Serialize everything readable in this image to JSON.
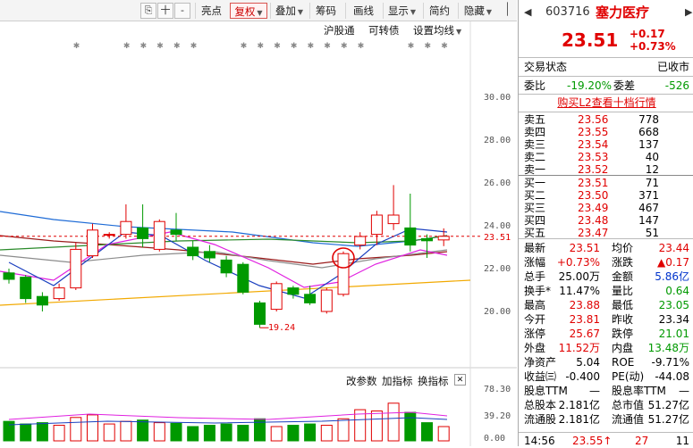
{
  "toolbar": {
    "buttons": [
      "亮点",
      "复权",
      "叠加",
      "筹码",
      "画线",
      "显示",
      "简约",
      "隐藏"
    ],
    "icon_labels": [
      "十",
      "-"
    ]
  },
  "chart_overlay": {
    "links": [
      "沪股通",
      "可转债",
      "设置均线"
    ],
    "indicator_links": [
      "改参数",
      "加指标",
      "换指标"
    ],
    "close_x": "✕",
    "price_ticks": [
      "30.00",
      "28.00",
      "26.00",
      "24.00",
      "22.00",
      "20.00"
    ],
    "current_price_tag": "23.51",
    "low_marker_label": "19.24",
    "volume_ticks": [
      "78.30",
      "39.20",
      "0.00"
    ]
  },
  "colors": {
    "up": "#e00000",
    "down": "#009900",
    "ma_blue": "#1e6bd6",
    "ma_magenta": "#e020e0",
    "ma_orange": "#f2a900",
    "ma_darkred": "#9b1b1b",
    "ma_green": "#2a8a2a"
  },
  "header": {
    "code": "603716",
    "name": "塞力医疗",
    "price": "23.51",
    "change": "+0.17",
    "change_pct": "+0.73%"
  },
  "status": {
    "label": "交易状态",
    "value": "已收市"
  },
  "wei": {
    "wb_label": "委比",
    "wb_value": "-19.20%",
    "wc_label": "委差",
    "wc_value": "-526"
  },
  "l2_link": "购买L2查看十档行情",
  "asks": [
    {
      "label": "卖五",
      "price": "23.56",
      "vol": "778"
    },
    {
      "label": "卖四",
      "price": "23.55",
      "vol": "668"
    },
    {
      "label": "卖三",
      "price": "23.54",
      "vol": "137"
    },
    {
      "label": "卖二",
      "price": "23.53",
      "vol": "40"
    },
    {
      "label": "卖一",
      "price": "23.52",
      "vol": "12"
    }
  ],
  "bids": [
    {
      "label": "买一",
      "price": "23.51",
      "vol": "71"
    },
    {
      "label": "买二",
      "price": "23.50",
      "vol": "371"
    },
    {
      "label": "买三",
      "price": "23.49",
      "vol": "467"
    },
    {
      "label": "买四",
      "price": "23.48",
      "vol": "147"
    },
    {
      "label": "买五",
      "price": "23.47",
      "vol": "51"
    }
  ],
  "stats": [
    {
      "l1": "最新",
      "v1": "23.51",
      "c1": "red",
      "l2": "均价",
      "v2": "23.44",
      "c2": "red"
    },
    {
      "l1": "涨幅",
      "v1": "+0.73%",
      "c1": "red",
      "l2": "涨跌",
      "v2": "▲0.17",
      "c2": "red"
    },
    {
      "l1": "总手",
      "v1": "25.00万",
      "c1": "",
      "l2": "金额",
      "v2": "5.86亿",
      "c2": "blue"
    },
    {
      "l1": "换手*",
      "v1": "11.47%",
      "c1": "",
      "l2": "量比",
      "v2": "0.64",
      "c2": "green"
    },
    {
      "l1": "最高",
      "v1": "23.88",
      "c1": "red",
      "l2": "最低",
      "v2": "23.05",
      "c2": "green"
    },
    {
      "l1": "今开",
      "v1": "23.81",
      "c1": "red",
      "l2": "昨收",
      "v2": "23.34",
      "c2": ""
    },
    {
      "l1": "涨停",
      "v1": "25.67",
      "c1": "red",
      "l2": "跌停",
      "v2": "21.01",
      "c2": "green"
    },
    {
      "l1": "外盘",
      "v1": "11.52万",
      "c1": "red",
      "l2": "内盘",
      "v2": "13.48万",
      "c2": "green"
    },
    {
      "l1": "净资产",
      "v1": "5.04",
      "c1": "",
      "l2": "ROE",
      "v2": "-9.71%",
      "c2": ""
    },
    {
      "l1": "收益㈢",
      "v1": "-0.400",
      "c1": "",
      "l2": "PE(动)",
      "v2": "-44.08",
      "c2": ""
    },
    {
      "l1": "股息TTM",
      "v1": "—",
      "c1": "",
      "l2": "股息率TTM",
      "v2": "—",
      "c2": ""
    },
    {
      "l1": "总股本",
      "v1": "2.181亿",
      "c1": "",
      "l2": "总市值",
      "v2": "51.27亿",
      "c2": ""
    },
    {
      "l1": "流通股",
      "v1": "2.181亿",
      "c1": "",
      "l2": "流通值",
      "v2": "51.27亿",
      "c2": ""
    }
  ],
  "tick_row": {
    "time": "14:56",
    "price": "23.55↑",
    "vol": "27",
    "num": "11"
  },
  "chart_data": {
    "type": "candlestick",
    "ylim": [
      19.0,
      31.0
    ],
    "ticks": [
      30,
      28,
      26,
      24,
      22,
      20
    ],
    "last_price": 23.51,
    "candles": [
      {
        "o": 21.8,
        "c": 21.5,
        "h": 22.0,
        "l": 21.3
      },
      {
        "o": 21.6,
        "c": 20.6,
        "h": 21.7,
        "l": 20.4
      },
      {
        "o": 20.7,
        "c": 20.3,
        "h": 20.9,
        "l": 20.0
      },
      {
        "o": 20.6,
        "c": 21.1,
        "h": 21.3,
        "l": 20.5
      },
      {
        "o": 21.1,
        "c": 22.9,
        "h": 23.2,
        "l": 21.0
      },
      {
        "o": 22.6,
        "c": 23.8,
        "h": 24.1,
        "l": 22.5
      },
      {
        "o": 23.6,
        "c": 23.6,
        "h": 23.7,
        "l": 23.4
      },
      {
        "o": 23.6,
        "c": 24.2,
        "h": 25.0,
        "l": 23.4
      },
      {
        "o": 23.9,
        "c": 23.4,
        "h": 25.0,
        "l": 23.0
      },
      {
        "o": 22.9,
        "c": 24.2,
        "h": 24.3,
        "l": 22.8
      },
      {
        "o": 23.8,
        "c": 23.6,
        "h": 24.6,
        "l": 23.3
      },
      {
        "o": 23.0,
        "c": 22.6,
        "h": 23.3,
        "l": 22.4
      },
      {
        "o": 22.8,
        "c": 22.5,
        "h": 23.1,
        "l": 22.3
      },
      {
        "o": 22.4,
        "c": 21.8,
        "h": 22.6,
        "l": 21.6
      },
      {
        "o": 22.2,
        "c": 20.9,
        "h": 22.3,
        "l": 20.8
      },
      {
        "o": 20.4,
        "c": 19.4,
        "h": 20.5,
        "l": 19.24
      },
      {
        "o": 20.1,
        "c": 21.3,
        "h": 21.4,
        "l": 20.0
      },
      {
        "o": 21.1,
        "c": 20.8,
        "h": 21.2,
        "l": 20.6
      },
      {
        "o": 20.8,
        "c": 20.4,
        "h": 21.2,
        "l": 20.3
      },
      {
        "o": 20.0,
        "c": 21.0,
        "h": 21.1,
        "l": 19.9
      },
      {
        "o": 20.8,
        "c": 22.7,
        "h": 22.8,
        "l": 20.7
      },
      {
        "o": 23.1,
        "c": 23.5,
        "h": 23.7,
        "l": 22.9
      },
      {
        "o": 23.6,
        "c": 24.5,
        "h": 24.7,
        "l": 23.1
      },
      {
        "o": 24.1,
        "c": 24.5,
        "h": 25.9,
        "l": 23.8
      },
      {
        "o": 23.9,
        "c": 23.1,
        "h": 25.5,
        "l": 22.8
      },
      {
        "o": 23.4,
        "c": 23.3,
        "h": 23.6,
        "l": 22.5
      },
      {
        "o": 23.34,
        "c": 23.51,
        "h": 23.88,
        "l": 23.05
      }
    ],
    "volume_ylim": [
      0,
      78.3
    ],
    "volumes": [
      30,
      26,
      28,
      24,
      36,
      40,
      26,
      30,
      32,
      28,
      27,
      22,
      24,
      26,
      24,
      34,
      22,
      24,
      26,
      24,
      34,
      48,
      46,
      58,
      44,
      28,
      22
    ]
  }
}
